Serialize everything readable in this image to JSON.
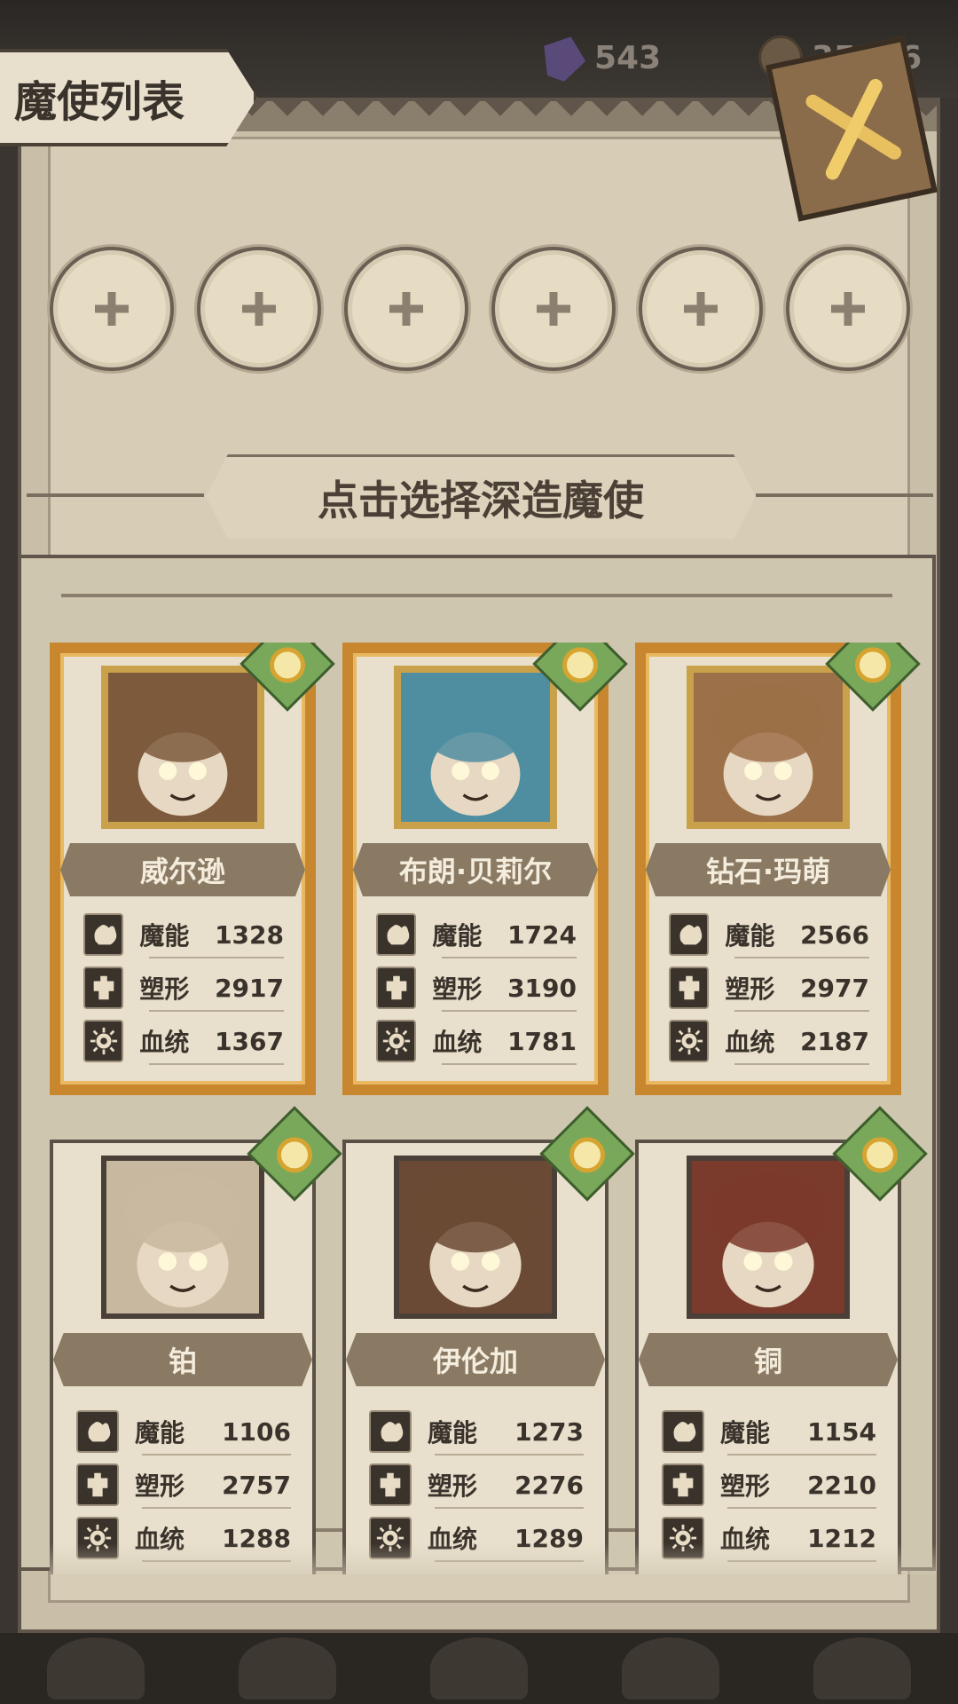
{
  "resources": {
    "gems": "543",
    "coins": "35",
    "coins_tail": "36"
  },
  "header": {
    "title": "魔使列表"
  },
  "slots": [
    "+",
    "+",
    "+",
    "+",
    "+",
    "+"
  ],
  "prompt": "点击选择深造魔使",
  "stat_labels": {
    "magic": "魔能",
    "shape": "塑形",
    "blood": "血统"
  },
  "characters": [
    {
      "name": "威尔逊",
      "rarity": "gold",
      "magic": "1328",
      "shape": "2917",
      "blood": "1367",
      "portrait_color": "#7d5a3c"
    },
    {
      "name": "布朗·贝莉尔",
      "rarity": "gold",
      "magic": "1724",
      "shape": "3190",
      "blood": "1781",
      "portrait_color": "#4f8ea0"
    },
    {
      "name": "钻石·玛萌",
      "rarity": "gold",
      "magic": "2566",
      "shape": "2977",
      "blood": "2187",
      "portrait_color": "#9c7048"
    },
    {
      "name": "铂",
      "rarity": "normal",
      "magic": "1106",
      "shape": "2757",
      "blood": "1288",
      "portrait_color": "#c9b8a0"
    },
    {
      "name": "伊伦加",
      "rarity": "normal",
      "magic": "1273",
      "shape": "2276",
      "blood": "1289",
      "portrait_color": "#6a4a34"
    },
    {
      "name": "铜",
      "rarity": "normal",
      "magic": "1154",
      "shape": "2210",
      "blood": "1212",
      "portrait_color": "#7a3a2c"
    }
  ]
}
